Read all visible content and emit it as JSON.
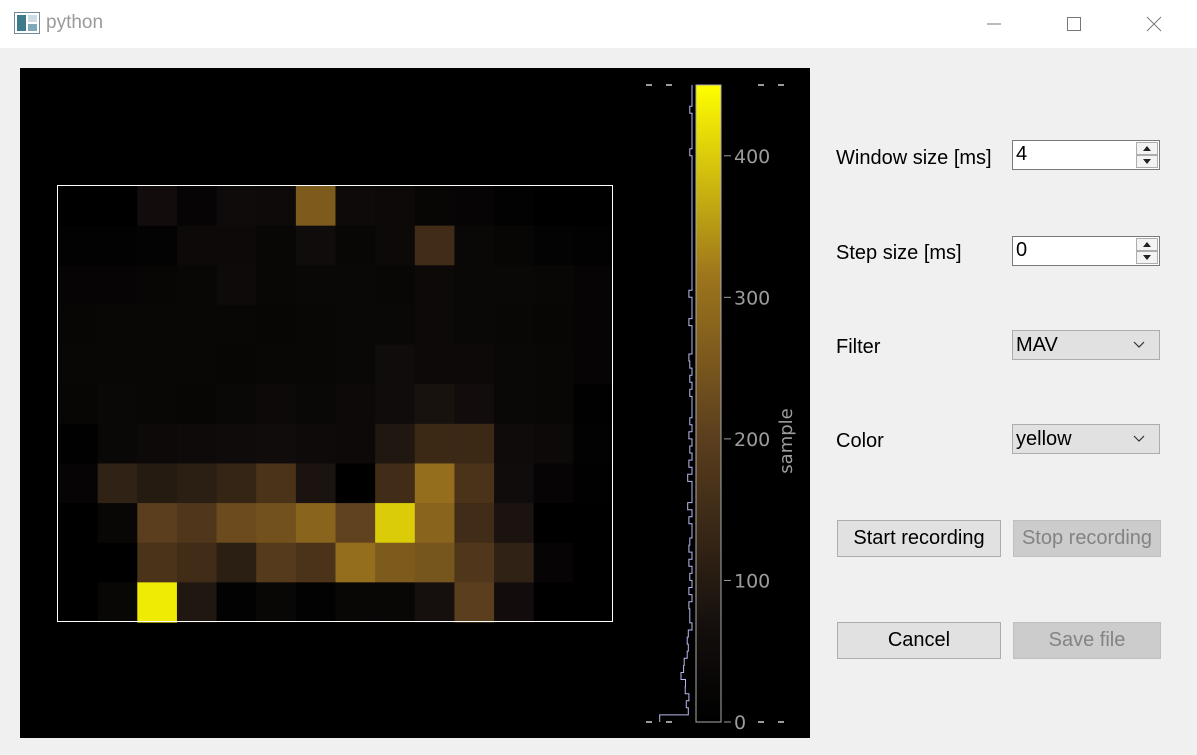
{
  "window": {
    "title": "python",
    "icons": {
      "app": "python-app-icon",
      "minimize": "minimize-icon",
      "maximize": "maximize-icon",
      "close": "close-icon"
    }
  },
  "heatmap": {
    "colormap": "yellow",
    "rows": 11,
    "cols": 14,
    "values": [
      [
        0,
        0,
        60,
        20,
        50,
        45,
        260,
        45,
        40,
        25,
        20,
        10,
        0,
        0
      ],
      [
        10,
        10,
        15,
        40,
        40,
        30,
        55,
        30,
        40,
        150,
        35,
        25,
        15,
        10
      ],
      [
        20,
        20,
        25,
        30,
        45,
        30,
        35,
        35,
        30,
        40,
        35,
        35,
        30,
        20
      ],
      [
        25,
        30,
        30,
        30,
        30,
        25,
        30,
        35,
        35,
        40,
        35,
        30,
        25,
        20
      ],
      [
        30,
        30,
        30,
        30,
        25,
        30,
        30,
        35,
        55,
        40,
        40,
        35,
        30,
        20
      ],
      [
        25,
        35,
        30,
        25,
        35,
        40,
        35,
        40,
        55,
        75,
        60,
        35,
        30,
        5
      ],
      [
        5,
        35,
        40,
        45,
        50,
        55,
        45,
        40,
        90,
        140,
        140,
        50,
        40,
        10
      ],
      [
        20,
        120,
        100,
        110,
        130,
        170,
        80,
        0,
        150,
        300,
        170,
        55,
        20,
        5
      ],
      [
        0,
        30,
        200,
        180,
        230,
        240,
        280,
        210,
        400,
        280,
        150,
        80,
        0,
        0
      ],
      [
        0,
        0,
        170,
        150,
        110,
        190,
        170,
        300,
        260,
        250,
        180,
        120,
        20,
        0
      ],
      [
        0,
        30,
        430,
        90,
        10,
        30,
        10,
        30,
        30,
        70,
        200,
        60,
        0,
        0
      ]
    ]
  },
  "histogram": {
    "axis_title": "sample",
    "range": [
      0,
      450
    ],
    "ticks": [
      "0",
      "100",
      "200",
      "300",
      "400"
    ],
    "tick_values": [
      0,
      100,
      200,
      300,
      400
    ]
  },
  "controls": {
    "window_size": {
      "label": "Window size [ms]",
      "value": "4"
    },
    "step_size": {
      "label": "Step size [ms]",
      "value": "0"
    },
    "filter": {
      "label": "Filter",
      "value": "MAV"
    },
    "color": {
      "label": "Color",
      "value": "yellow"
    }
  },
  "buttons": {
    "start_recording": "Start recording",
    "stop_recording": "Stop recording",
    "cancel": "Cancel",
    "save_file": "Save file"
  },
  "colors": {
    "plot_background": "#000000",
    "colormap_low": "#000000",
    "colormap_mid": "#6b4a1d",
    "colormap_high": "#ffff00",
    "histogram_line": "#b8b8f0"
  }
}
